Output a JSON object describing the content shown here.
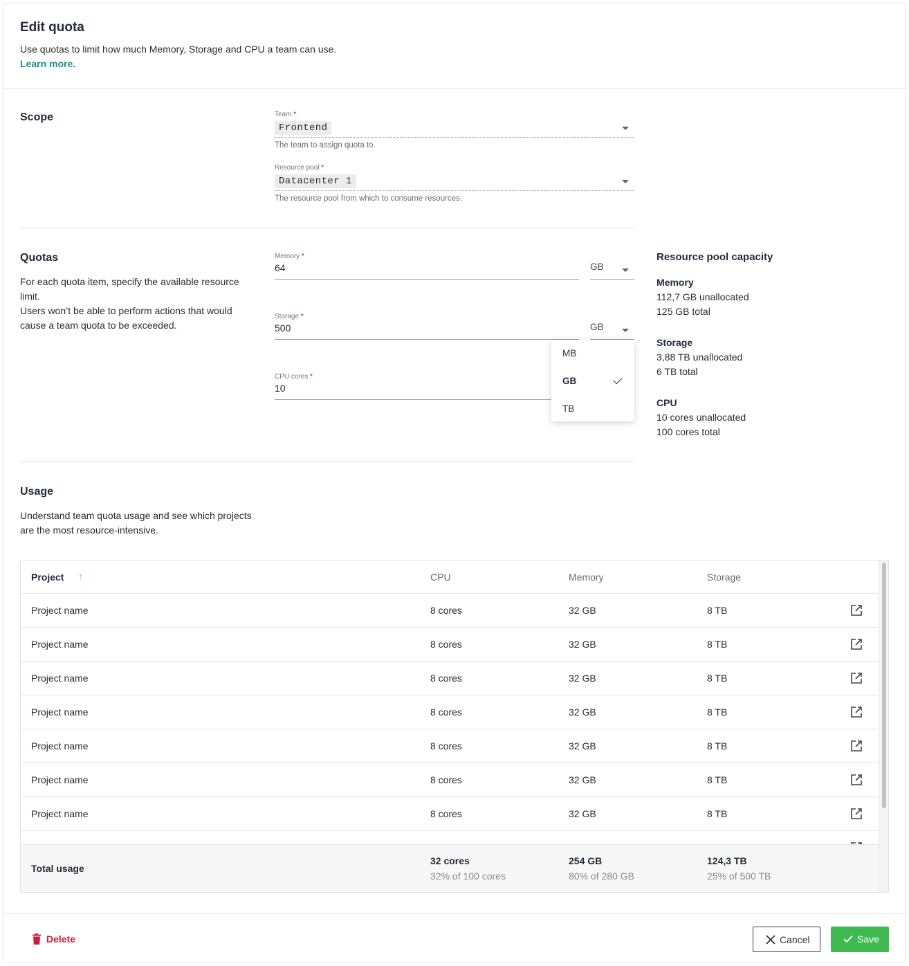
{
  "header": {
    "title": "Edit quota",
    "subtitle": "Use quotas to limit how much Memory, Storage and CPU a team can use.",
    "learn_more": "Learn more."
  },
  "scope": {
    "title": "Scope",
    "team": {
      "label": "Team",
      "value": "Frontend",
      "hint": "The team to assign quota to."
    },
    "pool": {
      "label": "Resource pool",
      "value": "Datacenter 1",
      "hint": "The resource pool from which to consume resources."
    }
  },
  "quotas": {
    "title": "Quotas",
    "desc1": "For each quota item, specify the available resource limit.",
    "desc2": "Users won’t be able to perform actions that would cause a team quota to be exceeded.",
    "memory": {
      "label": "Memory",
      "value": "64",
      "unit": "GB"
    },
    "storage": {
      "label": "Storage",
      "value": "500",
      "unit": "GB"
    },
    "cpu": {
      "label": "CPU cores",
      "value": "10"
    },
    "unit_options": [
      "MB",
      "GB",
      "TB"
    ],
    "selected_unit": "GB"
  },
  "capacity": {
    "title": "Resource pool capacity",
    "memory": {
      "heading": "Memory",
      "line1": "112,7 GB unallocated",
      "line2": "125 GB total"
    },
    "storage": {
      "heading": "Storage",
      "line1": "3,88 TB unallocated",
      "line2": "6 TB total"
    },
    "cpu": {
      "heading": "CPU",
      "line1": "10 cores unallocated",
      "line2": "100 cores total"
    }
  },
  "usage": {
    "title": "Usage",
    "desc": "Understand team quota usage and see which projects are the most resource-intensive.",
    "columns": {
      "project": "Project",
      "cpu": "CPU",
      "memory": "Memory",
      "storage": "Storage"
    },
    "sort_arrow": "↑",
    "rows": [
      {
        "project": "Project name",
        "cpu": "8 cores",
        "memory": "32 GB",
        "storage": "8 TB"
      },
      {
        "project": "Project name",
        "cpu": "8 cores",
        "memory": "32 GB",
        "storage": "8 TB"
      },
      {
        "project": "Project name",
        "cpu": "8 cores",
        "memory": "32 GB",
        "storage": "8 TB"
      },
      {
        "project": "Project name",
        "cpu": "8 cores",
        "memory": "32 GB",
        "storage": "8 TB"
      },
      {
        "project": "Project name",
        "cpu": "8 cores",
        "memory": "32 GB",
        "storage": "8 TB"
      },
      {
        "project": "Project name",
        "cpu": "8 cores",
        "memory": "32 GB",
        "storage": "8 TB"
      },
      {
        "project": "Project name",
        "cpu": "8 cores",
        "memory": "32 GB",
        "storage": "8 TB"
      }
    ],
    "total": {
      "label": "Total usage",
      "cpu": "32 cores",
      "cpu_sub": "32% of 100 cores",
      "memory": "254 GB",
      "memory_sub": "80% of 280 GB",
      "storage": "124,3 TB",
      "storage_sub": "25% of 500 TB"
    }
  },
  "footer": {
    "delete": "Delete",
    "cancel": "Cancel",
    "save": "Save"
  },
  "colors": {
    "accent": "#1a8c8c",
    "danger": "#d11a3c",
    "save": "#3fb950",
    "sort": "#e8a13a"
  }
}
